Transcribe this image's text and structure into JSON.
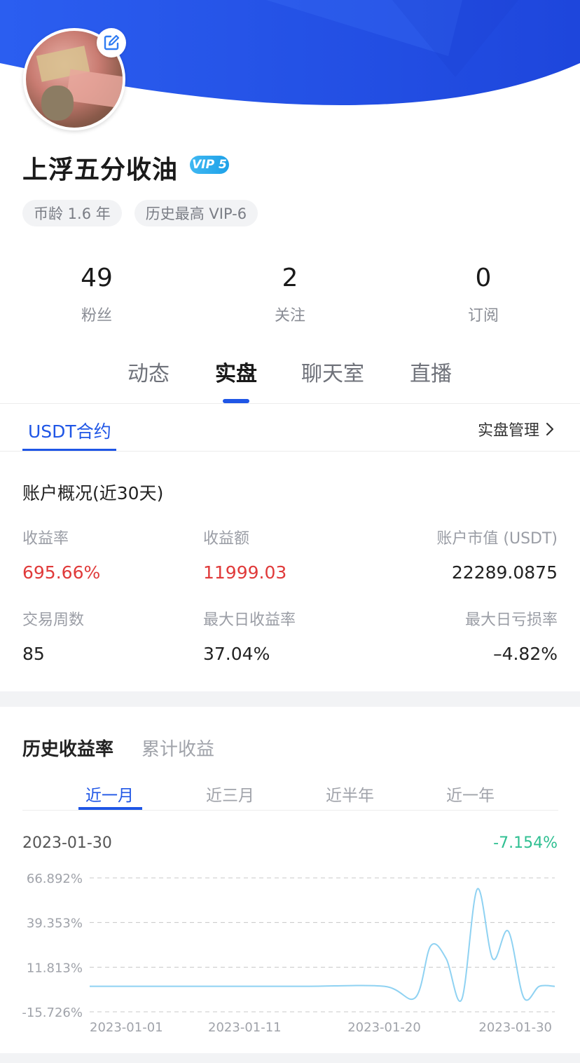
{
  "profile": {
    "name": "上浮五分收油",
    "vip": "VIP 5",
    "tags": [
      "币龄 1.6 年",
      "历史最高 VIP-6"
    ]
  },
  "stats": [
    {
      "num": "49",
      "label": "粉丝"
    },
    {
      "num": "2",
      "label": "关注"
    },
    {
      "num": "0",
      "label": "订阅"
    }
  ],
  "main_tabs": [
    "动态",
    "实盘",
    "聊天室",
    "直播"
  ],
  "sub": {
    "tab": "USDT合约",
    "manage": "实盘管理"
  },
  "overview": {
    "title": "账户概况(近30天)",
    "items": [
      {
        "k": "收益率",
        "v": "695.66%"
      },
      {
        "k": "收益额",
        "v": "11999.03"
      },
      {
        "k": "账户市值 (USDT)",
        "v": "22289.0875"
      },
      {
        "k": "交易周数",
        "v": "85"
      },
      {
        "k": "最大日收益率",
        "v": "37.04%"
      },
      {
        "k": "最大日亏损率",
        "v": "–4.82%"
      }
    ]
  },
  "history": {
    "tabs": [
      "历史收益率",
      "累计收益"
    ],
    "ranges": [
      "近一月",
      "近三月",
      "近半年",
      "近一年"
    ],
    "current_date": "2023-01-30",
    "current_value": "-7.154%"
  },
  "colors": {
    "brand_blue": "#1f56e6",
    "red": "#e03a3a",
    "green": "#2ebf91",
    "line": "#8fd2f2"
  },
  "chart_data": {
    "type": "line",
    "y_ticks": [
      "66.892%",
      "39.353%",
      "11.813%",
      "-15.726%"
    ],
    "x_ticks": [
      "2023-01-01",
      "2023-01-11",
      "2023-01-20",
      "2023-01-30"
    ],
    "ylim": [
      -15.726,
      66.892
    ],
    "xlim": [
      "2023-01-01",
      "2023-01-31"
    ],
    "series": [
      {
        "x": [
          "2023-01-01",
          "2023-01-05",
          "2023-01-10",
          "2023-01-15",
          "2023-01-20",
          "2023-01-22",
          "2023-01-23",
          "2023-01-24",
          "2023-01-25",
          "2023-01-26",
          "2023-01-27",
          "2023-01-28",
          "2023-01-29",
          "2023-01-30",
          "2023-01-31"
        ],
        "values": [
          0,
          0,
          0,
          0,
          0,
          -7,
          25,
          17,
          -8,
          60,
          17,
          34,
          -7,
          0,
          0
        ]
      }
    ]
  }
}
